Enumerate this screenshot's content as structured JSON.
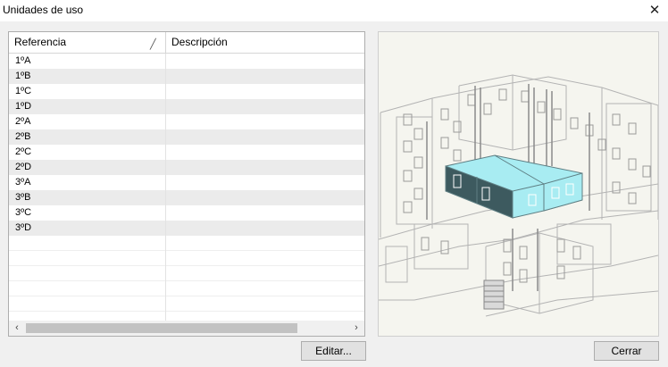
{
  "window": {
    "title": "Unidades de uso",
    "close_glyph": "✕"
  },
  "table": {
    "columns": [
      "Referencia",
      "Descripción"
    ],
    "sort_indicator": "╱",
    "rows": [
      {
        "ref": "1ºA",
        "desc": ""
      },
      {
        "ref": "1ºB",
        "desc": ""
      },
      {
        "ref": "1ºC",
        "desc": ""
      },
      {
        "ref": "1ºD",
        "desc": ""
      },
      {
        "ref": "2ºA",
        "desc": ""
      },
      {
        "ref": "2ºB",
        "desc": ""
      },
      {
        "ref": "2ºC",
        "desc": ""
      },
      {
        "ref": "2ºD",
        "desc": ""
      },
      {
        "ref": "3ºA",
        "desc": ""
      },
      {
        "ref": "3ºB",
        "desc": ""
      },
      {
        "ref": "3ºC",
        "desc": ""
      },
      {
        "ref": "3ºD",
        "desc": ""
      }
    ],
    "scroll_left": "‹",
    "scroll_right": "›"
  },
  "buttons": {
    "edit": "Editar...",
    "close": "Cerrar"
  },
  "preview": {
    "highlight_color": "#a8ecf2",
    "dark_face": "#3d5a5f",
    "wire_color": "#b0b0b0"
  }
}
